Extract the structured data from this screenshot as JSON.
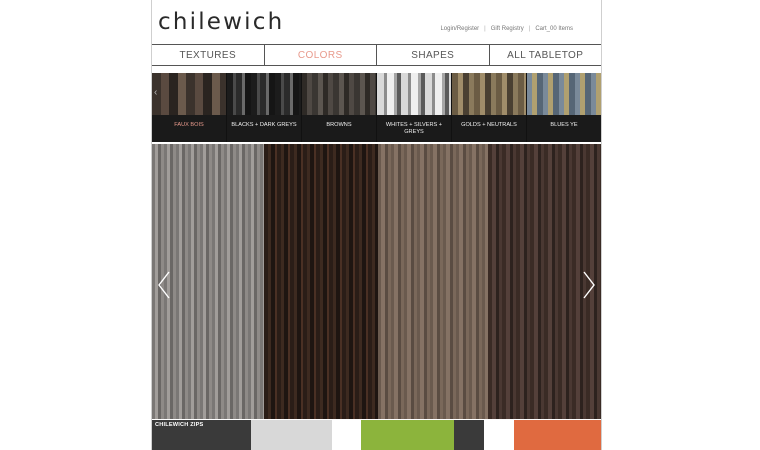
{
  "header": {
    "logo": "chilewich",
    "links": [
      "Login/Register",
      "Gift Registry",
      "Cart_00 Items"
    ],
    "separator": "|"
  },
  "nav": {
    "tabs": [
      {
        "label": "TEXTURES",
        "active": false
      },
      {
        "label": "COLORS",
        "active": true
      },
      {
        "label": "SHAPES",
        "active": false
      },
      {
        "label": "ALL TABLETOP",
        "active": false
      }
    ]
  },
  "color_strip": {
    "prev_icon": "‹",
    "swatches": [
      {
        "label": "FAUX BOIS",
        "active": true
      },
      {
        "label": "BLACKS + DARK GREYS",
        "active": false
      },
      {
        "label": "BROWNS",
        "active": false
      },
      {
        "label": "WHITES + SILVERS + GREYS",
        "active": false
      },
      {
        "label": "GOLDS + NEUTRALS",
        "active": false
      },
      {
        "label": "BLUES YE",
        "active": false
      }
    ]
  },
  "hero": {
    "prev_icon": "chevron-left-icon",
    "next_icon": "chevron-right-icon"
  },
  "promos": [
    {
      "label": "CHILEWICH ZIPS"
    }
  ],
  "colors": {
    "accent": "#e89a8c",
    "active_bar": "#e07a6c"
  }
}
